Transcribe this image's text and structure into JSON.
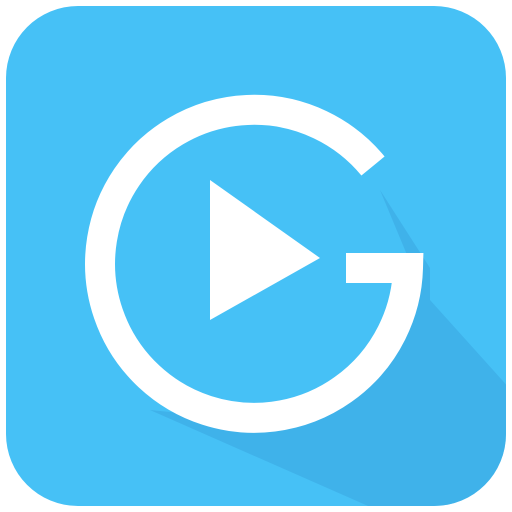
{
  "app_icon": {
    "name": "video-player-app-icon",
    "tile_color": "#46c1f6",
    "shadow_color": "#3ba6e0",
    "glyph_color": "#ffffff",
    "glyph": "letter-g-with-play-triangle"
  }
}
